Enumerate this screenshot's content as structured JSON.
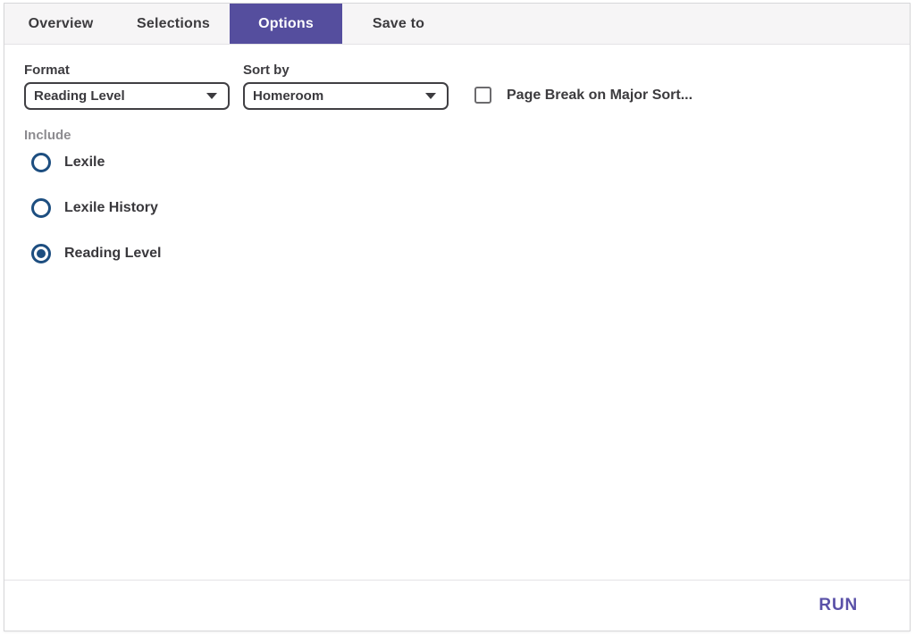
{
  "tabs": [
    {
      "label": "Overview",
      "active": false
    },
    {
      "label": "Selections",
      "active": false
    },
    {
      "label": "Options",
      "active": true
    },
    {
      "label": "Save to",
      "active": false
    }
  ],
  "options_panel": {
    "format": {
      "label": "Format",
      "value": "Reading Level"
    },
    "sort_by": {
      "label": "Sort by",
      "value": "Homeroom"
    },
    "page_break": {
      "label": "Page Break on Major Sort...",
      "checked": false
    },
    "include": {
      "label": "Include",
      "options": [
        {
          "label": "Lexile",
          "selected": false
        },
        {
          "label": "Lexile History",
          "selected": false
        },
        {
          "label": "Reading Level",
          "selected": true
        }
      ]
    }
  },
  "footer": {
    "run_label": "RUN"
  },
  "colors": {
    "active_tab_purple": "#554e9e",
    "run_purple": "#5a51a8",
    "radio_navy": "#1d4e80",
    "tabbar_bg": "#f6f5f6"
  },
  "icons": {
    "dropdown_caret": "caret-down-icon"
  }
}
